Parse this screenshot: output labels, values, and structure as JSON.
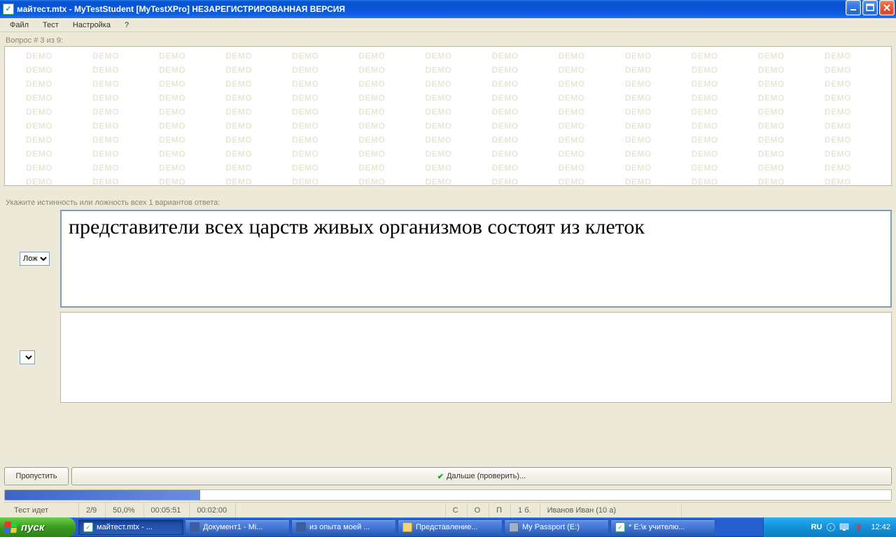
{
  "window": {
    "title": "майтест.mtx - MyTestStudent [MyTestXPro] НЕЗАРЕГИСТРИРОВАННАЯ ВЕРСИЯ"
  },
  "menu": {
    "file": "Файл",
    "test": "Тест",
    "settings": "Настройка",
    "help": "?"
  },
  "question": {
    "header": "Вопрос # 3 из 9:",
    "watermark": "DEMO",
    "instruction": "Укажите истинность или ложность всех 1 вариантов ответа:",
    "answer1_text": "представители всех царств живых организмов состоят из клеток",
    "answer1_value": "Лож",
    "answer2_text": "",
    "answer2_value": ""
  },
  "buttons": {
    "skip": "Пропустить",
    "next": "Дальше (проверить)..."
  },
  "status": {
    "state": "Тест идет",
    "progress": "2/9",
    "percent": "50,0%",
    "time1": "00:05:51",
    "time2": "00:02:00",
    "c": "С",
    "o": "О",
    "p": "П",
    "points": "1 б.",
    "student": "Иванов Иван (10 а)"
  },
  "taskbar": {
    "start": "пуск",
    "tasks": [
      "майтест.mtx - ...",
      "Документ1 - Mi...",
      "из опыта моей ...",
      "Представление...",
      "My Passport (E:)",
      "* E:\\к учителю..."
    ],
    "lang": "RU",
    "clock": "12:42"
  }
}
